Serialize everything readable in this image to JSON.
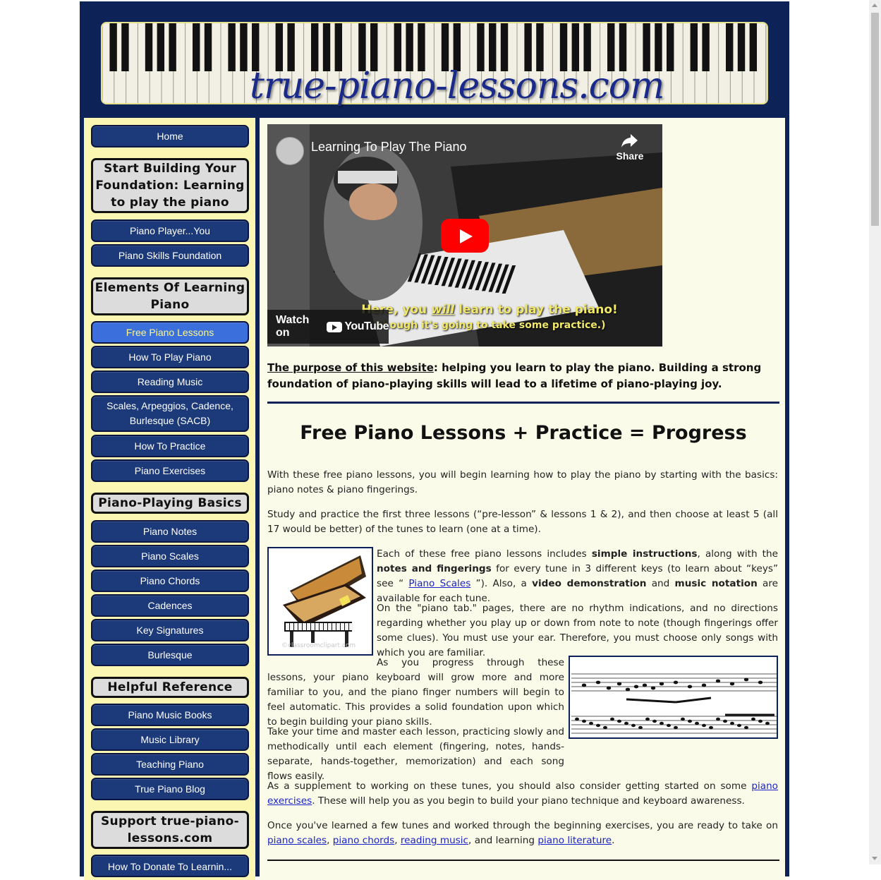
{
  "header": {
    "site_title": "true-piano-lessons.com"
  },
  "sidebar": {
    "home": "Home",
    "section1": "Start Building Your Foundation: Learning to play the piano",
    "s1_items": [
      "Piano Player...You",
      "Piano Skills Foundation"
    ],
    "section2": "Elements Of Learning Piano",
    "s2_items": [
      "Free Piano Lessons",
      "How To Play Piano",
      "Reading Music",
      "Scales, Arpeggios, Cadence, Burlesque (SACB)",
      "How To Practice",
      "Piano Exercises"
    ],
    "section3": "Piano-Playing Basics",
    "s3_items": [
      "Piano Notes",
      "Piano Scales",
      "Piano Chords",
      "Cadences",
      "Key Signatures",
      "Burlesque"
    ],
    "section4": "Helpful Reference",
    "s4_items": [
      "Piano Music Books",
      "Music Library",
      "Teaching Piano",
      "True Piano Blog"
    ],
    "section5": "Support true-piano-lessons.com",
    "s5_partial": "How To Donate To Learnin..."
  },
  "video": {
    "title": "Learning To Play The Piano",
    "share_label": "Share",
    "caption_line1_a": "Here, you ",
    "caption_line1_b": "will",
    "caption_line1_c": " learn to play the piano!",
    "caption_line2": "(though it's going to take some practice.)",
    "watch_on": "Watch on",
    "youtube": "YouTube"
  },
  "purpose": {
    "lead": "The purpose of this website",
    "text": ": helping you learn to play the piano.  Building a strong foundation of piano-playing skills will lead to a lifetime of piano-playing joy."
  },
  "heading": "Free Piano Lessons + Practice = Progress",
  "paragraphs": {
    "p1": "With these free piano lessons, you will begin learning how to play the piano by starting with the basics: piano notes & piano fingerings.",
    "p2": "Study and practice the first three lessons (“pre-lesson” & lessons 1 & 2), and then choose at least 5 (all 17 would be better) of the tunes to learn (one at a time).",
    "p3_a": "Each of these free piano lessons includes ",
    "p3_b": "simple instructions",
    "p3_c": ", along with the ",
    "p3_d": "notes and fingerings",
    "p3_e": " for every tune in 3 different keys (to learn about “keys” see “ ",
    "p3_link": "Piano Scales",
    "p3_f": " ”). Also, a ",
    "p3_g": "video demonstration",
    "p3_h": " and ",
    "p3_i": "music notation",
    "p3_j": " are available for each tune.",
    "p4": "On the \"piano tab.\" pages, there are no rhythm indications, and no directions regarding whether you play up or down from note to note (though fingerings offer some clues). You must use your ear. Therefore, you must choose only songs with which you are familiar.",
    "p5": "As you progress through these lessons, your piano keyboard will grow more and more familiar to you, and the piano finger numbers will begin to feel automatic. This provides a solid foundation upon which to begin building your piano skills.",
    "p6": "Take your time and master each lesson, practicing slowly and methodically until each element (fingering, notes, hands-separate, hands-together, memorization) and each song flows easily.",
    "p7_a": "As a supplement to working on these tunes, you should also consider getting started on some ",
    "p7_link": "piano exercises",
    "p7_b": ". These will help you as you begin to build your piano technique and keyboard awareness.",
    "p8_a": "Once you've learned a few tunes and worked through the beginning exercises, you are ready to take on ",
    "p8_l1": "piano scales",
    "p8_s1": ", ",
    "p8_l2": "piano chords",
    "p8_s2": ", ",
    "p8_l3": "reading music",
    "p8_b": ", and learning ",
    "p8_l4": "piano literature",
    "p8_c": "."
  },
  "images": {
    "piano_watermark": "©classroomclipart.com"
  }
}
